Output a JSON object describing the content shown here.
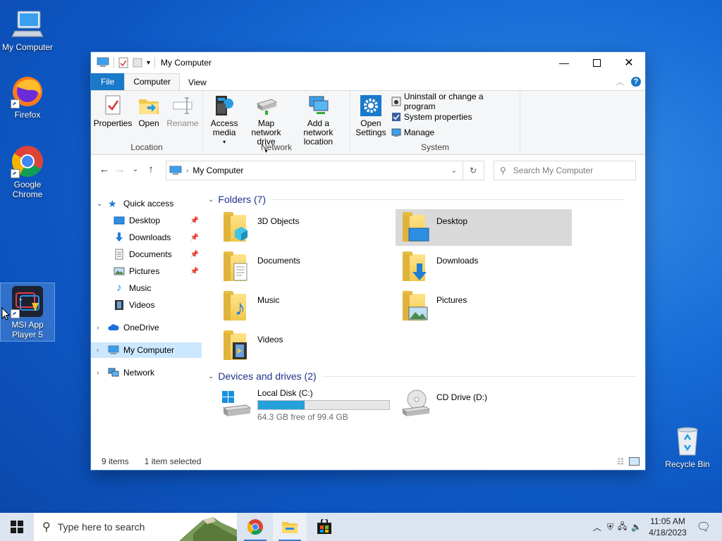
{
  "desktop": {
    "icons": [
      {
        "label": "My Computer"
      },
      {
        "label": "Firefox"
      },
      {
        "label": "Google Chrome"
      },
      {
        "label": "MSI App Player 5"
      },
      {
        "label": "Recycle Bin"
      }
    ]
  },
  "window": {
    "title": "My Computer",
    "tabs": [
      "File",
      "Computer",
      "View"
    ],
    "ribbon": {
      "location": {
        "name": "Location",
        "buttons": [
          "Properties",
          "Open",
          "Rename"
        ]
      },
      "network": {
        "name": "Network",
        "buttons": [
          "Access media",
          "Map network drive",
          "Add a network location"
        ]
      },
      "system": {
        "name": "System",
        "open_settings": "Open Settings",
        "items": [
          "Uninstall or change a program",
          "System properties",
          "Manage"
        ]
      }
    },
    "address": {
      "path": "My Computer",
      "search_placeholder": "Search My Computer"
    },
    "nav": {
      "quick_access": "Quick access",
      "quick_items": [
        "Desktop",
        "Downloads",
        "Documents",
        "Pictures",
        "Music",
        "Videos"
      ],
      "onedrive": "OneDrive",
      "my_computer": "My Computer",
      "network": "Network"
    },
    "folders_header": "Folders (7)",
    "folders": [
      "3D Objects",
      "Desktop",
      "Documents",
      "Downloads",
      "Music",
      "Pictures",
      "Videos"
    ],
    "devices_header": "Devices and drives (2)",
    "drives": [
      {
        "name": "Local Disk (C:)",
        "free": "64.3 GB free of 99.4 GB",
        "used_fraction": 0.353
      },
      {
        "name": "CD Drive (D:)"
      }
    ],
    "status": {
      "items": "9 items",
      "selected": "1 item selected"
    }
  },
  "taskbar": {
    "search_placeholder": "Type here to search",
    "time": "11:05 AM",
    "date": "4/18/2023"
  },
  "colors": {
    "accent": "#1979ca",
    "selection": "#cce8ff",
    "progress": "#26a0da"
  }
}
